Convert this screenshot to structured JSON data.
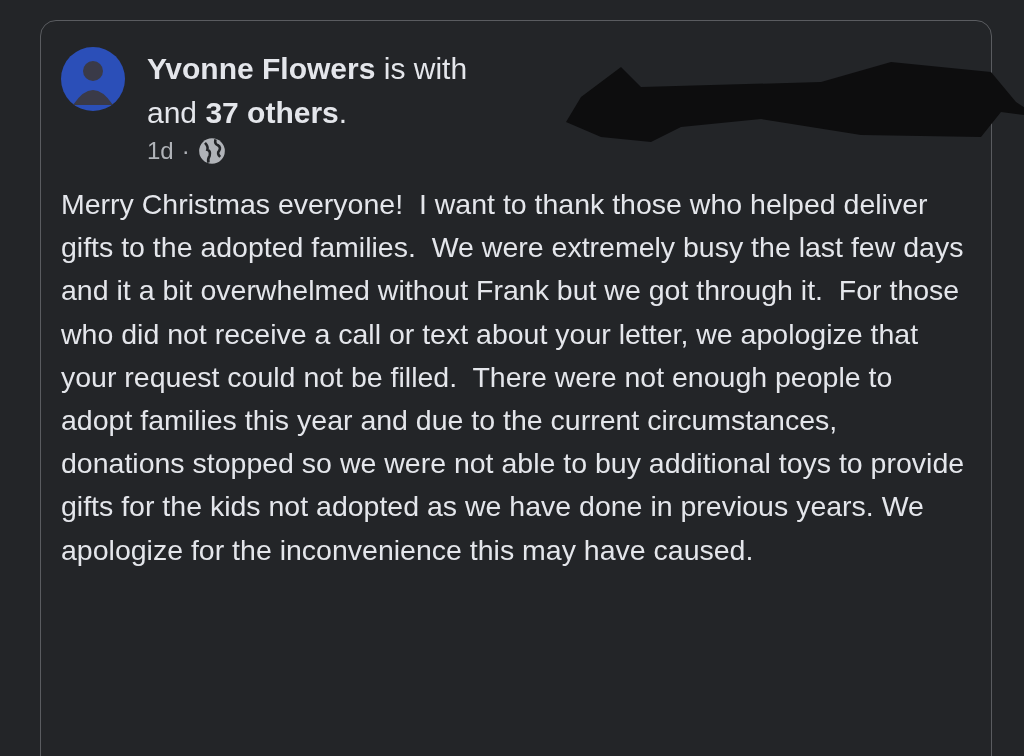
{
  "post": {
    "author_line": "**Yvonne Flowers** is with",
    "others_line": "and **37 others**.",
    "time": "1d",
    "separator": "·",
    "body": "Merry Christmas everyone!  I want to thank those who helped deliver gifts to the adopted families.  We were extremely busy the last few days and it a bit overwhelmed without Frank but we got through it.  For those who did not receive a call or text about your letter, we apologize that your request could not be filled.  There were not enough people to adopt families this year and due to the current circumstances, donations stopped so we were not able to buy additional toys to provide gifts for the kids not adopted as we have done in previous years. We apologize for the inconvenience this may have caused."
  }
}
